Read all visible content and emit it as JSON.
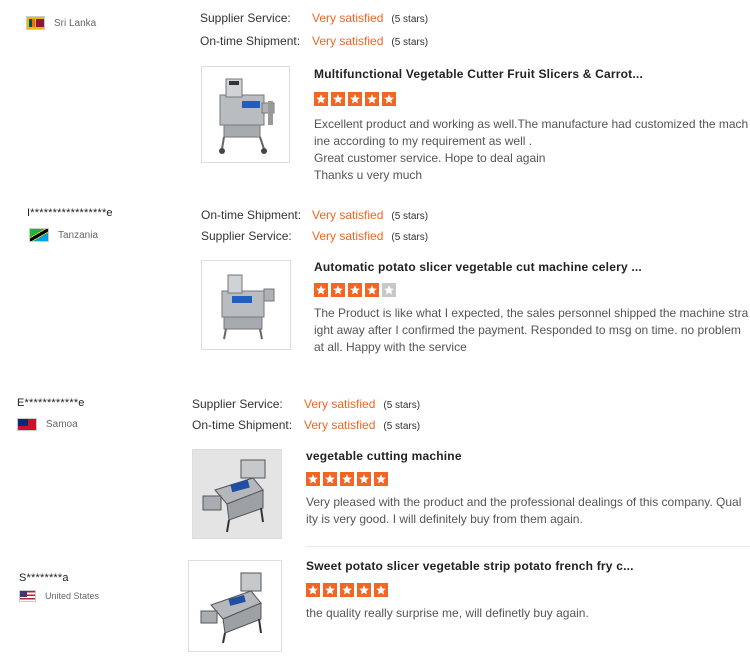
{
  "reviews": [
    {
      "username": "",
      "country": "Sri Lanka",
      "flag": "sri-lanka",
      "ratings": [
        {
          "label": "Supplier Service:",
          "value": "Very satisfied",
          "stars": "(5 stars)"
        },
        {
          "label": "On-time Shipment:",
          "value": "Very satisfied",
          "stars": "(5 stars)"
        }
      ],
      "product_title": "Multifunctional Vegetable Cutter Fruit Slicers & Carrot...",
      "star_count": 5,
      "text": "Excellent product and working as well.The manufacture had customized the machine according to my requirement as well .\nGreat customer service. Hope to deal again\nThanks u very much"
    },
    {
      "username": "I*****************e",
      "country": "Tanzania",
      "flag": "tanzania",
      "ratings": [
        {
          "label": "On-time Shipment:",
          "value": "Very satisfied",
          "stars": "(5 stars)"
        },
        {
          "label": "Supplier Service:",
          "value": "Very satisfied",
          "stars": "(5 stars)"
        }
      ],
      "product_title": "Automatic potato slicer vegetable cut machine celery ...",
      "star_count": 4,
      "text": "The Product is like what I expected, the sales personnel shipped the machine straight away after I confirmed the payment. Responded to msg on time. no problem at all. Happy with the service"
    },
    {
      "username": "E************e",
      "country": "Samoa",
      "flag": "samoa",
      "ratings": [
        {
          "label": "Supplier Service:",
          "value": "Very satisfied",
          "stars": "(5 stars)"
        },
        {
          "label": "On-time Shipment:",
          "value": "Very satisfied",
          "stars": "(5 stars)"
        }
      ],
      "product_title": "vegetable cutting machine",
      "star_count": 5,
      "text": "Very pleased with the product and the professional dealings of this company. Quality is very good. I will definitely buy from them again."
    },
    {
      "username": "S********a",
      "country": "United States",
      "flag": "united-states",
      "ratings": [],
      "product_title": "Sweet potato slicer vegetable strip potato french fry c...",
      "star_count": 5,
      "text": "the quality really surprise me, will definetly buy again."
    }
  ],
  "colors": {
    "accent": "#f26522",
    "star_empty": "#c8c8c8"
  }
}
